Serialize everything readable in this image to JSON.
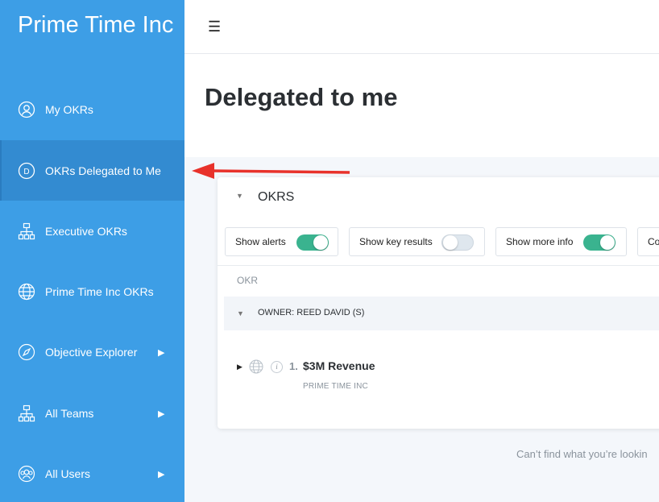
{
  "app": {
    "brand": "Prime Time Inc"
  },
  "sidebar": {
    "items": [
      {
        "label": "My OKRs",
        "icon": "user-circle-icon",
        "active": false,
        "has_submenu": false
      },
      {
        "label": "OKRs Delegated to Me",
        "icon": "d-circle-icon",
        "active": true,
        "has_submenu": false
      },
      {
        "label": "Executive OKRs",
        "icon": "org-chart-icon",
        "active": false,
        "has_submenu": false
      },
      {
        "label": "Prime Time Inc OKRs",
        "icon": "globe-icon",
        "active": false,
        "has_submenu": false
      },
      {
        "label": "Objective Explorer",
        "icon": "compass-icon",
        "active": false,
        "has_submenu": true
      },
      {
        "label": "All Teams",
        "icon": "org-chart-icon",
        "active": false,
        "has_submenu": true
      },
      {
        "label": "All Users",
        "icon": "users-icon",
        "active": false,
        "has_submenu": true
      }
    ]
  },
  "header": {
    "title": "Delegated to me"
  },
  "card": {
    "title": "OKRS",
    "toggles": [
      {
        "label": "Show alerts",
        "on": true
      },
      {
        "label": "Show key results",
        "on": false
      },
      {
        "label": "Show more info",
        "on": true
      },
      {
        "label": "Co",
        "on": null
      }
    ],
    "column_header": "OKR",
    "owner_group": "OWNER: REED DAVID (S)",
    "okrs": [
      {
        "number": "1.",
        "title": "$3M Revenue",
        "owner": "PRIME TIME INC"
      }
    ]
  },
  "footer_hint": "Can’t find what you’re lookin",
  "colors": {
    "sidebar": "#3d9ee6",
    "sidebar_active": "#338bd1",
    "toggle_on": "#3ab38f",
    "annotation_arrow": "#e8322b"
  }
}
